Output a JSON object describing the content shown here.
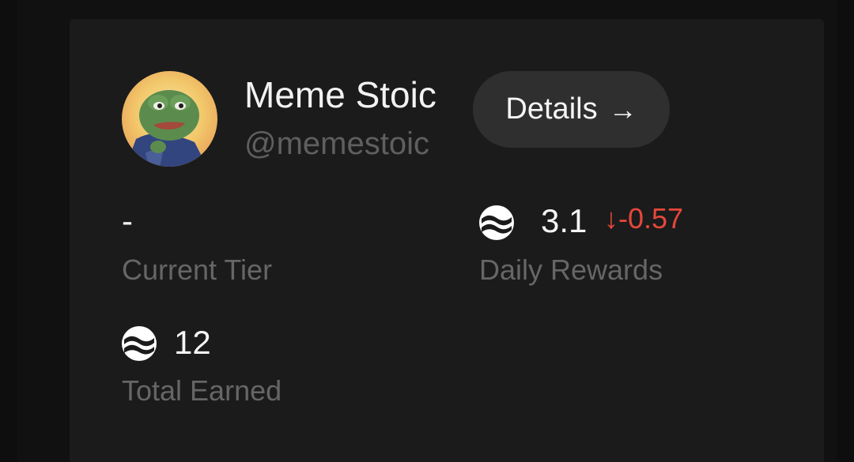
{
  "profile": {
    "name": "Meme Stoic",
    "handle": "@memestoic"
  },
  "details_button": {
    "label": "Details",
    "arrow": "→"
  },
  "stats": {
    "current_tier": {
      "value": "-",
      "label": "Current Tier"
    },
    "daily_rewards": {
      "value": "3.1",
      "change_arrow": "↓",
      "change": "-0.57",
      "label": "Daily Rewards",
      "icon": "sui-coin-icon"
    },
    "total_earned": {
      "value": "12",
      "label": "Total Earned",
      "icon": "sui-coin-icon"
    }
  },
  "colors": {
    "background": "#0e0e0e",
    "card": "#1b1b1b",
    "button": "#2f2f2f",
    "text_primary": "#f2f2f2",
    "text_muted": "#666666",
    "negative": "#e5473b"
  }
}
